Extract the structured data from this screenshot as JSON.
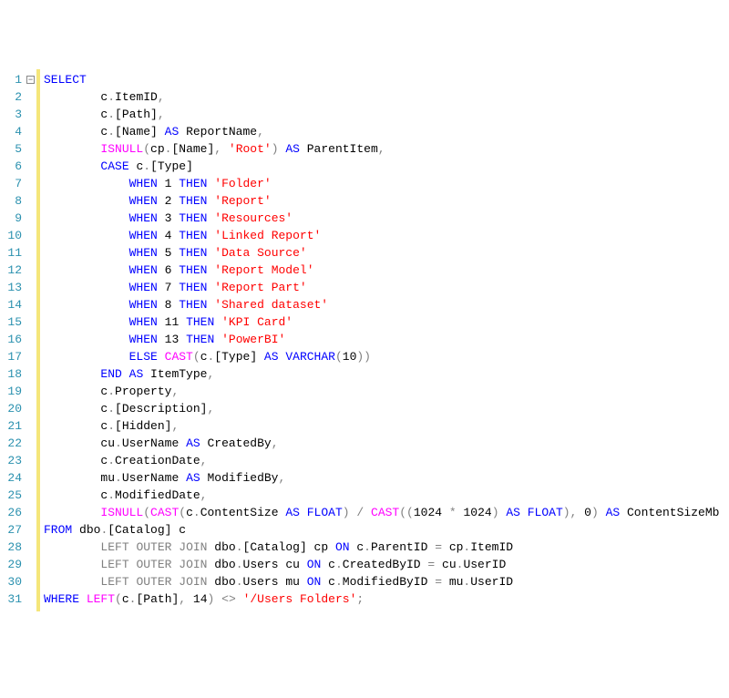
{
  "editor": {
    "lines": [
      {
        "n": 1,
        "fold": true,
        "tokens": [
          [
            "kw",
            "SELECT"
          ]
        ]
      },
      {
        "n": 2,
        "indent": 2,
        "tokens": [
          [
            "norm",
            "c"
          ],
          [
            "gray",
            "."
          ],
          [
            "norm",
            "ItemID"
          ],
          [
            "gray",
            ","
          ]
        ]
      },
      {
        "n": 3,
        "indent": 2,
        "tokens": [
          [
            "norm",
            "c"
          ],
          [
            "gray",
            "."
          ],
          [
            "norm",
            "[Path]"
          ],
          [
            "gray",
            ","
          ]
        ]
      },
      {
        "n": 4,
        "indent": 2,
        "tokens": [
          [
            "norm",
            "c"
          ],
          [
            "gray",
            "."
          ],
          [
            "norm",
            "[Name] "
          ],
          [
            "kw",
            "AS"
          ],
          [
            "norm",
            " ReportName"
          ],
          [
            "gray",
            ","
          ]
        ]
      },
      {
        "n": 5,
        "indent": 2,
        "tokens": [
          [
            "func",
            "ISNULL"
          ],
          [
            "gray",
            "("
          ],
          [
            "norm",
            "cp"
          ],
          [
            "gray",
            "."
          ],
          [
            "norm",
            "[Name]"
          ],
          [
            "gray",
            ","
          ],
          [
            "norm",
            " "
          ],
          [
            "str",
            "'Root'"
          ],
          [
            "gray",
            ")"
          ],
          [
            "norm",
            " "
          ],
          [
            "kw",
            "AS"
          ],
          [
            "norm",
            " ParentItem"
          ],
          [
            "gray",
            ","
          ]
        ]
      },
      {
        "n": 6,
        "indent": 2,
        "tokens": [
          [
            "kw",
            "CASE"
          ],
          [
            "norm",
            " c"
          ],
          [
            "gray",
            "."
          ],
          [
            "norm",
            "[Type]"
          ]
        ]
      },
      {
        "n": 7,
        "indent": 3,
        "tokens": [
          [
            "kw",
            "WHEN"
          ],
          [
            "norm",
            " 1 "
          ],
          [
            "kw",
            "THEN"
          ],
          [
            "norm",
            " "
          ],
          [
            "str",
            "'Folder'"
          ]
        ]
      },
      {
        "n": 8,
        "indent": 3,
        "tokens": [
          [
            "kw",
            "WHEN"
          ],
          [
            "norm",
            " 2 "
          ],
          [
            "kw",
            "THEN"
          ],
          [
            "norm",
            " "
          ],
          [
            "str",
            "'Report'"
          ]
        ]
      },
      {
        "n": 9,
        "indent": 3,
        "tokens": [
          [
            "kw",
            "WHEN"
          ],
          [
            "norm",
            " 3 "
          ],
          [
            "kw",
            "THEN"
          ],
          [
            "norm",
            " "
          ],
          [
            "str",
            "'Resources'"
          ]
        ]
      },
      {
        "n": 10,
        "indent": 3,
        "tokens": [
          [
            "kw",
            "WHEN"
          ],
          [
            "norm",
            " 4 "
          ],
          [
            "kw",
            "THEN"
          ],
          [
            "norm",
            " "
          ],
          [
            "str",
            "'Linked Report'"
          ]
        ]
      },
      {
        "n": 11,
        "indent": 3,
        "tokens": [
          [
            "kw",
            "WHEN"
          ],
          [
            "norm",
            " 5 "
          ],
          [
            "kw",
            "THEN"
          ],
          [
            "norm",
            " "
          ],
          [
            "str",
            "'Data Source'"
          ]
        ]
      },
      {
        "n": 12,
        "indent": 3,
        "tokens": [
          [
            "kw",
            "WHEN"
          ],
          [
            "norm",
            " 6 "
          ],
          [
            "kw",
            "THEN"
          ],
          [
            "norm",
            " "
          ],
          [
            "str",
            "'Report Model'"
          ]
        ]
      },
      {
        "n": 13,
        "indent": 3,
        "tokens": [
          [
            "kw",
            "WHEN"
          ],
          [
            "norm",
            " 7 "
          ],
          [
            "kw",
            "THEN"
          ],
          [
            "norm",
            " "
          ],
          [
            "str",
            "'Report Part'"
          ]
        ]
      },
      {
        "n": 14,
        "indent": 3,
        "tokens": [
          [
            "kw",
            "WHEN"
          ],
          [
            "norm",
            " 8 "
          ],
          [
            "kw",
            "THEN"
          ],
          [
            "norm",
            " "
          ],
          [
            "str",
            "'Shared dataset'"
          ]
        ]
      },
      {
        "n": 15,
        "indent": 3,
        "tokens": [
          [
            "kw",
            "WHEN"
          ],
          [
            "norm",
            " 11 "
          ],
          [
            "kw",
            "THEN"
          ],
          [
            "norm",
            " "
          ],
          [
            "str",
            "'KPI Card'"
          ]
        ]
      },
      {
        "n": 16,
        "indent": 3,
        "tokens": [
          [
            "kw",
            "WHEN"
          ],
          [
            "norm",
            " 13 "
          ],
          [
            "kw",
            "THEN"
          ],
          [
            "norm",
            " "
          ],
          [
            "str",
            "'PowerBI'"
          ]
        ]
      },
      {
        "n": 17,
        "indent": 3,
        "tokens": [
          [
            "kw",
            "ELSE"
          ],
          [
            "norm",
            " "
          ],
          [
            "func",
            "CAST"
          ],
          [
            "gray",
            "("
          ],
          [
            "norm",
            "c"
          ],
          [
            "gray",
            "."
          ],
          [
            "norm",
            "[Type] "
          ],
          [
            "kw",
            "AS"
          ],
          [
            "norm",
            " "
          ],
          [
            "kw",
            "VARCHAR"
          ],
          [
            "gray",
            "("
          ],
          [
            "norm",
            "10"
          ],
          [
            "gray",
            "))"
          ]
        ]
      },
      {
        "n": 18,
        "indent": 2,
        "tokens": [
          [
            "kw",
            "END"
          ],
          [
            "norm",
            " "
          ],
          [
            "kw",
            "AS"
          ],
          [
            "norm",
            " ItemType"
          ],
          [
            "gray",
            ","
          ]
        ]
      },
      {
        "n": 19,
        "indent": 2,
        "tokens": [
          [
            "norm",
            "c"
          ],
          [
            "gray",
            "."
          ],
          [
            "norm",
            "Property"
          ],
          [
            "gray",
            ","
          ]
        ]
      },
      {
        "n": 20,
        "indent": 2,
        "tokens": [
          [
            "norm",
            "c"
          ],
          [
            "gray",
            "."
          ],
          [
            "norm",
            "[Description]"
          ],
          [
            "gray",
            ","
          ]
        ]
      },
      {
        "n": 21,
        "indent": 2,
        "tokens": [
          [
            "norm",
            "c"
          ],
          [
            "gray",
            "."
          ],
          [
            "norm",
            "[Hidden]"
          ],
          [
            "gray",
            ","
          ]
        ]
      },
      {
        "n": 22,
        "indent": 2,
        "tokens": [
          [
            "norm",
            "cu"
          ],
          [
            "gray",
            "."
          ],
          [
            "norm",
            "UserName "
          ],
          [
            "kw",
            "AS"
          ],
          [
            "norm",
            " CreatedBy"
          ],
          [
            "gray",
            ","
          ]
        ]
      },
      {
        "n": 23,
        "indent": 2,
        "tokens": [
          [
            "norm",
            "c"
          ],
          [
            "gray",
            "."
          ],
          [
            "norm",
            "CreationDate"
          ],
          [
            "gray",
            ","
          ]
        ]
      },
      {
        "n": 24,
        "indent": 2,
        "tokens": [
          [
            "norm",
            "mu"
          ],
          [
            "gray",
            "."
          ],
          [
            "norm",
            "UserName "
          ],
          [
            "kw",
            "AS"
          ],
          [
            "norm",
            " ModifiedBy"
          ],
          [
            "gray",
            ","
          ]
        ]
      },
      {
        "n": 25,
        "indent": 2,
        "tokens": [
          [
            "norm",
            "c"
          ],
          [
            "gray",
            "."
          ],
          [
            "norm",
            "ModifiedDate"
          ],
          [
            "gray",
            ","
          ]
        ]
      },
      {
        "n": 26,
        "indent": 2,
        "tokens": [
          [
            "func",
            "ISNULL"
          ],
          [
            "gray",
            "("
          ],
          [
            "func",
            "CAST"
          ],
          [
            "gray",
            "("
          ],
          [
            "norm",
            "c"
          ],
          [
            "gray",
            "."
          ],
          [
            "norm",
            "ContentSize "
          ],
          [
            "kw",
            "AS"
          ],
          [
            "norm",
            " "
          ],
          [
            "kw",
            "FLOAT"
          ],
          [
            "gray",
            ")"
          ],
          [
            "norm",
            " "
          ],
          [
            "gray",
            "/"
          ],
          [
            "norm",
            " "
          ],
          [
            "func",
            "CAST"
          ],
          [
            "gray",
            "(("
          ],
          [
            "norm",
            "1024 "
          ],
          [
            "gray",
            "*"
          ],
          [
            "norm",
            " 1024"
          ],
          [
            "gray",
            ")"
          ],
          [
            "norm",
            " "
          ],
          [
            "kw",
            "AS"
          ],
          [
            "norm",
            " "
          ],
          [
            "kw",
            "FLOAT"
          ],
          [
            "gray",
            "),"
          ],
          [
            "norm",
            " 0"
          ],
          [
            "gray",
            ")"
          ],
          [
            "norm",
            " "
          ],
          [
            "kw",
            "AS"
          ],
          [
            "norm",
            " ContentSizeMb"
          ]
        ]
      },
      {
        "n": 27,
        "indent": 0,
        "tokens": [
          [
            "kw",
            "FROM"
          ],
          [
            "norm",
            " dbo"
          ],
          [
            "gray",
            "."
          ],
          [
            "norm",
            "[Catalog] c"
          ]
        ]
      },
      {
        "n": 28,
        "indent": 2,
        "tokens": [
          [
            "gray",
            "LEFT"
          ],
          [
            "norm",
            " "
          ],
          [
            "gray",
            "OUTER"
          ],
          [
            "norm",
            " "
          ],
          [
            "gray",
            "JOIN"
          ],
          [
            "norm",
            " dbo"
          ],
          [
            "gray",
            "."
          ],
          [
            "norm",
            "[Catalog] cp "
          ],
          [
            "kw",
            "ON"
          ],
          [
            "norm",
            " c"
          ],
          [
            "gray",
            "."
          ],
          [
            "norm",
            "ParentID "
          ],
          [
            "gray",
            "="
          ],
          [
            "norm",
            " cp"
          ],
          [
            "gray",
            "."
          ],
          [
            "norm",
            "ItemID"
          ]
        ]
      },
      {
        "n": 29,
        "indent": 2,
        "tokens": [
          [
            "gray",
            "LEFT"
          ],
          [
            "norm",
            " "
          ],
          [
            "gray",
            "OUTER"
          ],
          [
            "norm",
            " "
          ],
          [
            "gray",
            "JOIN"
          ],
          [
            "norm",
            " dbo"
          ],
          [
            "gray",
            "."
          ],
          [
            "norm",
            "Users cu "
          ],
          [
            "kw",
            "ON"
          ],
          [
            "norm",
            " c"
          ],
          [
            "gray",
            "."
          ],
          [
            "norm",
            "CreatedByID "
          ],
          [
            "gray",
            "="
          ],
          [
            "norm",
            " cu"
          ],
          [
            "gray",
            "."
          ],
          [
            "norm",
            "UserID"
          ]
        ]
      },
      {
        "n": 30,
        "indent": 2,
        "tokens": [
          [
            "gray",
            "LEFT"
          ],
          [
            "norm",
            " "
          ],
          [
            "gray",
            "OUTER"
          ],
          [
            "norm",
            " "
          ],
          [
            "gray",
            "JOIN"
          ],
          [
            "norm",
            " dbo"
          ],
          [
            "gray",
            "."
          ],
          [
            "norm",
            "Users mu "
          ],
          [
            "kw",
            "ON"
          ],
          [
            "norm",
            " c"
          ],
          [
            "gray",
            "."
          ],
          [
            "norm",
            "ModifiedByID "
          ],
          [
            "gray",
            "="
          ],
          [
            "norm",
            " mu"
          ],
          [
            "gray",
            "."
          ],
          [
            "norm",
            "UserID"
          ]
        ]
      },
      {
        "n": 31,
        "indent": 0,
        "tokens": [
          [
            "kw",
            "WHERE"
          ],
          [
            "norm",
            " "
          ],
          [
            "func",
            "LEFT"
          ],
          [
            "gray",
            "("
          ],
          [
            "norm",
            "c"
          ],
          [
            "gray",
            "."
          ],
          [
            "norm",
            "[Path]"
          ],
          [
            "gray",
            ","
          ],
          [
            "norm",
            " 14"
          ],
          [
            "gray",
            ")"
          ],
          [
            "norm",
            " "
          ],
          [
            "gray",
            "<>"
          ],
          [
            "norm",
            " "
          ],
          [
            "str",
            "'/Users Folders'"
          ],
          [
            "gray",
            ";"
          ]
        ]
      }
    ],
    "indent_unit": "    ",
    "fold_glyph": "−"
  }
}
